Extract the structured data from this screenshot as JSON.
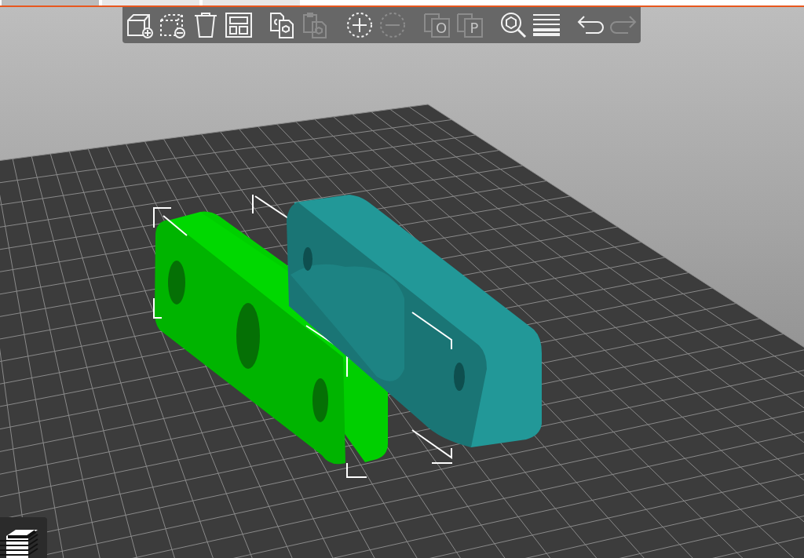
{
  "tab_strip": {
    "tabs": [
      {
        "selected": true
      },
      {
        "selected": false
      },
      {
        "selected": false
      }
    ]
  },
  "toolbar": {
    "items": [
      {
        "kind": "add",
        "disabled": false
      },
      {
        "kind": "delete",
        "disabled": false
      },
      {
        "kind": "delete_all",
        "disabled": false
      },
      {
        "kind": "arrange",
        "disabled": false
      },
      {
        "kind": "separator"
      },
      {
        "kind": "copy",
        "disabled": false
      },
      {
        "kind": "paste",
        "disabled": true
      },
      {
        "kind": "separator"
      },
      {
        "kind": "add_instance",
        "disabled": false
      },
      {
        "kind": "remove_instance",
        "disabled": true
      },
      {
        "kind": "separator"
      },
      {
        "kind": "split",
        "letter": "O",
        "disabled": true
      },
      {
        "kind": "split",
        "letter": "P",
        "disabled": true
      },
      {
        "kind": "separator"
      },
      {
        "kind": "search",
        "disabled": false
      },
      {
        "kind": "layers",
        "disabled": false
      },
      {
        "kind": "separator"
      },
      {
        "kind": "undo",
        "disabled": false
      },
      {
        "kind": "redo",
        "disabled": true
      }
    ]
  },
  "scene": {
    "objects": [
      {
        "kind": "plate",
        "selected": true,
        "color": "#00b400"
      },
      {
        "kind": "bracket",
        "selected": false,
        "color": "#1f8a8a"
      }
    ]
  },
  "layers_button": {
    "on": false
  }
}
